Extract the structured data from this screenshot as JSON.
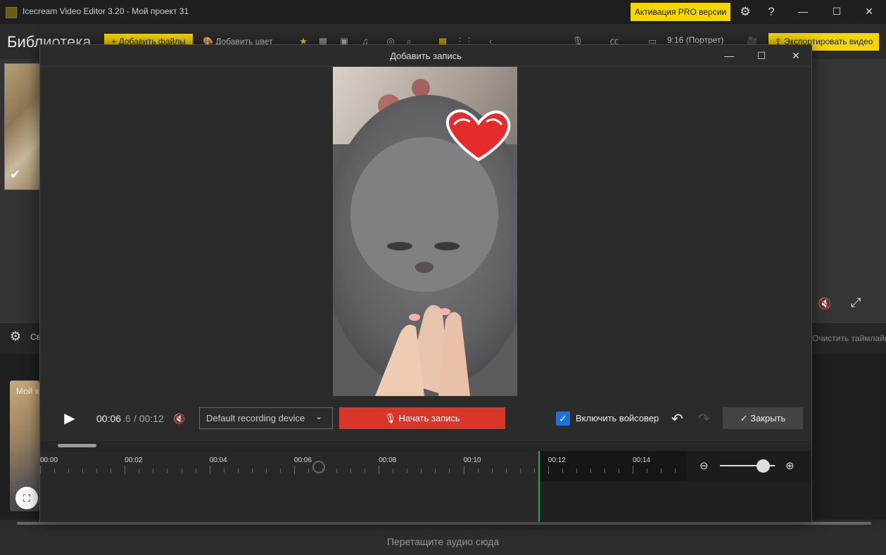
{
  "window": {
    "title": "Icecream Video Editor 3.20  -  Мой проект 31",
    "pro_button": "Активация PRO версии"
  },
  "toolbar": {
    "library_title": "Библиотека",
    "add_files": "+ Добавить файлы",
    "add_color": "Добавить цвет",
    "aspect_ratio": "9:16 (Портрет)",
    "export": "Экспортировать видео"
  },
  "settings": {
    "label": "Св",
    "clear_timeline": "Очистить таймлайн"
  },
  "track": {
    "label": "Мой к"
  },
  "drop_audio": "Перетащите аудио сюда",
  "dialog": {
    "title": "Добавить запись",
    "time_current": "00:06",
    "time_current_frac": ".6",
    "time_total": "/ 00:12",
    "device_value": "Default recording device",
    "record_button": "Начать запись",
    "voiceover_label": "Включить войсовер",
    "voiceover_checked": true,
    "close_button": "Закрыть",
    "timeline_ticks": [
      "00:00",
      "00:02",
      "00:04",
      "00:06",
      "00:08",
      "00:10",
      "00:12",
      "00:14"
    ]
  },
  "icons": {
    "settings": "gear-icon",
    "help": "help-icon",
    "minimize": "minimize-icon",
    "maximize": "maximize-icon",
    "close": "close-icon",
    "play": "play-icon",
    "mute": "mute-icon",
    "mic": "microphone-icon",
    "undo": "undo-icon",
    "redo": "redo-icon",
    "check": "check-icon",
    "zoom_in": "zoom-in-icon",
    "zoom_out": "zoom-out-icon",
    "fullscreen": "fullscreen-icon"
  },
  "colors": {
    "accent": "#f6d600",
    "record": "#d9362a",
    "checkbox": "#1c72d6",
    "playhead": "#1ba36b"
  }
}
